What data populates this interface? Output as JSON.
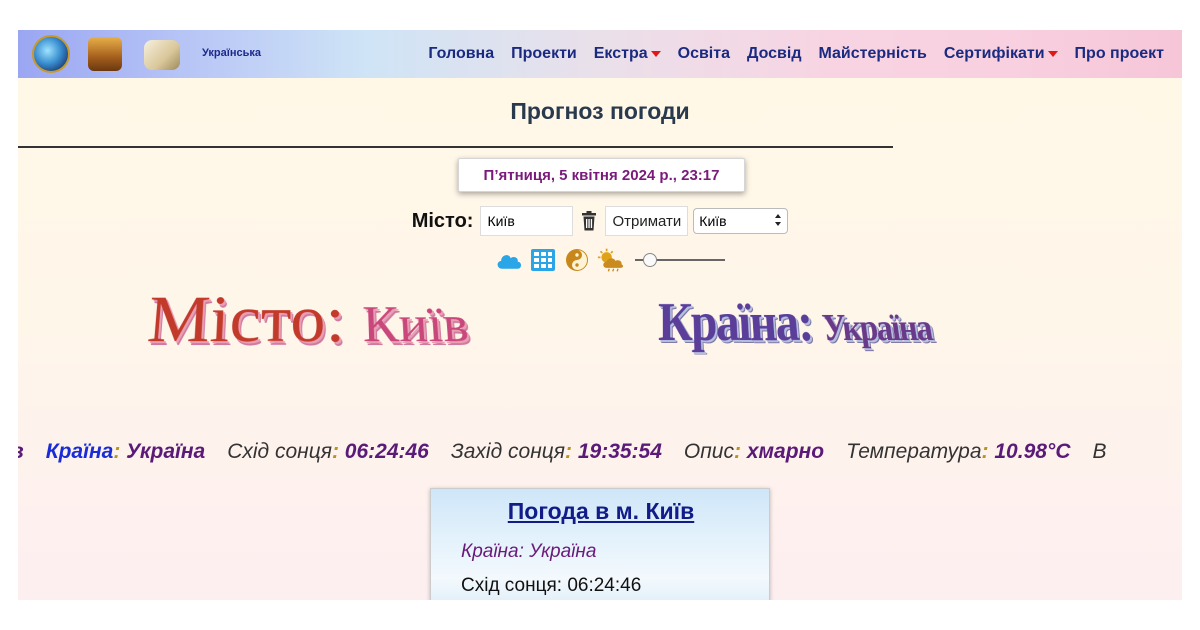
{
  "nav": {
    "language": "Українська",
    "items": [
      {
        "label": "Головна",
        "dropdown": false
      },
      {
        "label": "Проекти",
        "dropdown": false
      },
      {
        "label": "Екстра",
        "dropdown": true
      },
      {
        "label": "Освіта",
        "dropdown": false
      },
      {
        "label": "Досвід",
        "dropdown": false
      },
      {
        "label": "Майстерність",
        "dropdown": false
      },
      {
        "label": "Сертифікати",
        "dropdown": true
      },
      {
        "label": "Про проект",
        "dropdown": false
      }
    ],
    "logos": [
      "globe-logo",
      "treasure-chest-logo",
      "scroll-logo"
    ]
  },
  "page": {
    "title": "Прогноз погоди",
    "datetime": "П’ятниця, 5 квітня 2024 р., 23:17"
  },
  "controls": {
    "city_label": "Місто:",
    "city_value": "Київ",
    "get_button": "Отримати",
    "select_value": "Київ",
    "icons": [
      "cloud-icon",
      "grid-icon",
      "yin-yang-icon",
      "sun-cloud-icon"
    ],
    "slider_level": 0.1
  },
  "headline": {
    "city_prefix": "Місто:",
    "city_value": "Київ",
    "country_prefix": "Країна:",
    "country_value": "Україна"
  },
  "ticker": {
    "lead": "в",
    "items": [
      {
        "label": "Країна",
        "value": "Україна",
        "label_style": "blue"
      },
      {
        "label": "Схід сонця",
        "value": "06:24:46"
      },
      {
        "label": "Захід сонця",
        "value": "19:35:54"
      },
      {
        "label": "Опис",
        "value": "хмарно"
      },
      {
        "label": "Температура",
        "value": "10.98°C"
      }
    ],
    "tail": "В"
  },
  "card": {
    "title": "Погода в м. Київ",
    "country_label": "Країна:",
    "country_value": "Україна",
    "sunrise_label": "Схід сонця:",
    "sunrise_value": "06:24:46"
  },
  "colors": {
    "nav_text": "#1a2a80",
    "date_text": "#7a1a7a",
    "card_title": "#111c88",
    "caret": "#e01818"
  }
}
